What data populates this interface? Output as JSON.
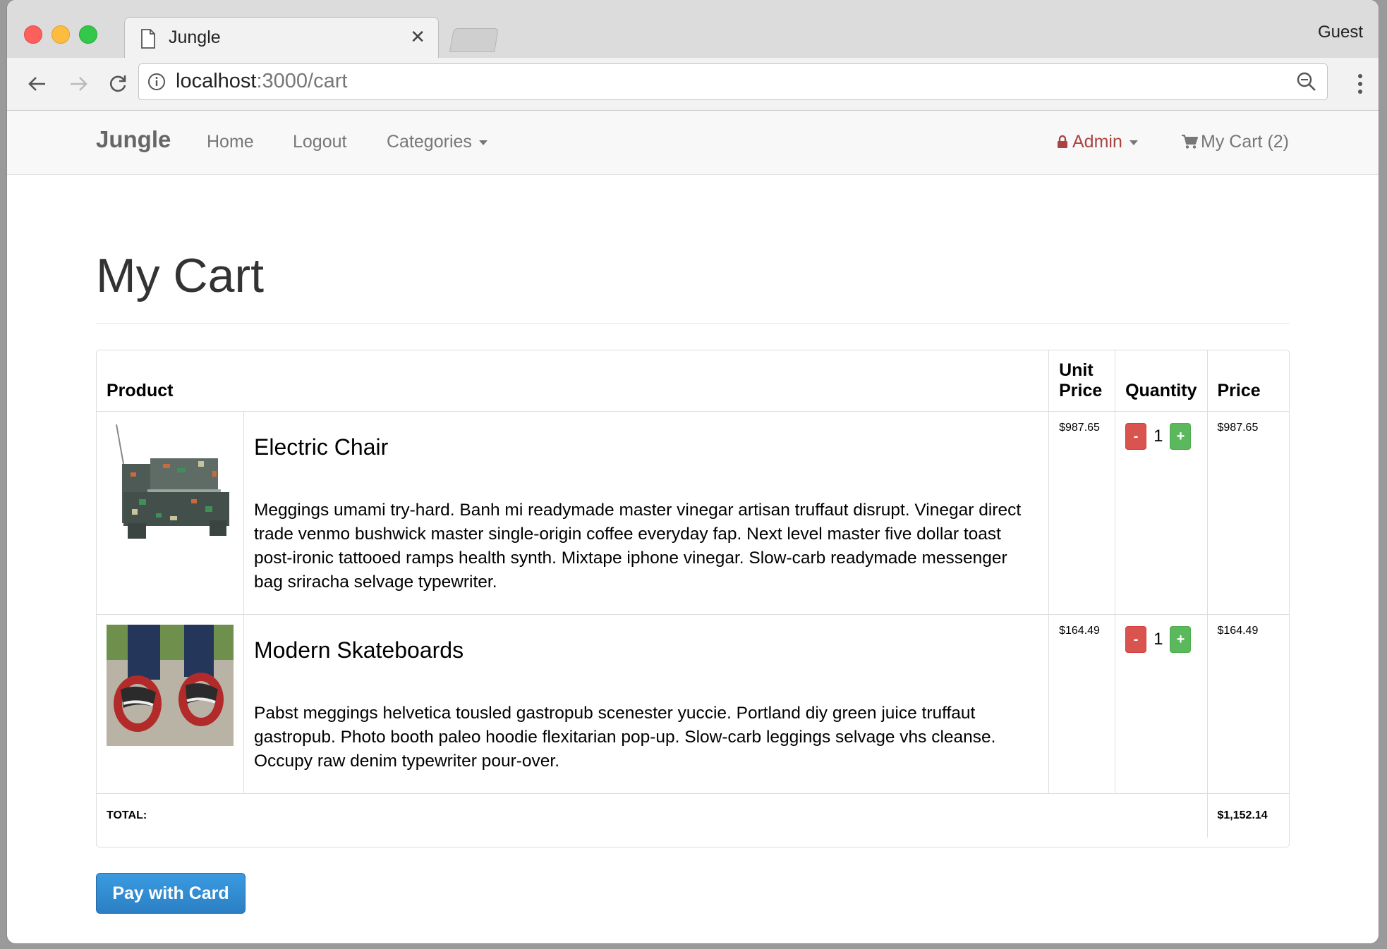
{
  "browser": {
    "tab_title": "Jungle",
    "profile": "Guest",
    "url_host": "localhost",
    "url_path": ":3000/cart"
  },
  "navbar": {
    "brand": "Jungle",
    "home": "Home",
    "logout": "Logout",
    "categories": "Categories",
    "admin": "Admin",
    "cart": "My Cart (2)"
  },
  "page": {
    "title": "My Cart"
  },
  "table": {
    "headers": {
      "product": "Product",
      "unit_price": "Unit Price",
      "quantity": "Quantity",
      "price": "Price"
    },
    "items": [
      {
        "name": "Electric Chair",
        "description": "Meggings umami try-hard. Banh mi readymade master vinegar artisan truffaut disrupt. Vinegar direct trade venmo bushwick master single-origin coffee everyday fap. Next level master five dollar toast post-ironic tattooed ramps health synth. Mixtape iphone vinegar. Slow-carb readymade messenger bag sriracha selvage typewriter.",
        "unit_price": "$987.65",
        "quantity": "1",
        "price": "$987.65"
      },
      {
        "name": "Modern Skateboards",
        "description": "Pabst meggings helvetica tousled gastropub scenester yuccie. Portland diy green juice truffaut gastropub. Photo booth paleo hoodie flexitarian pop-up. Slow-carb leggings selvage vhs cleanse. Occupy raw denim typewriter pour-over.",
        "unit_price": "$164.49",
        "quantity": "1",
        "price": "$164.49"
      }
    ],
    "minus": "-",
    "plus": "+",
    "total_label": "TOTAL:",
    "total_value": "$1,152.14"
  },
  "actions": {
    "pay": "Pay with Card"
  },
  "colors": {
    "minus_button": "#d9534f",
    "plus_button": "#5cb85c",
    "pay_button": "#337ab7",
    "admin_text": "#a94442"
  }
}
